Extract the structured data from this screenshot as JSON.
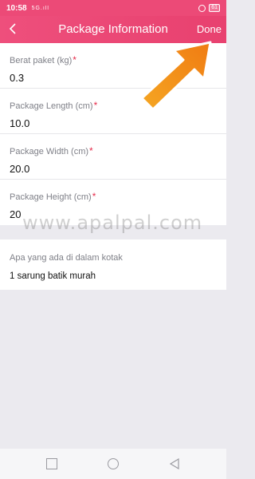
{
  "status_bar": {
    "time": "10:58",
    "signal": "5G.ıll",
    "battery": "61"
  },
  "header": {
    "title": "Package Information",
    "done_label": "Done"
  },
  "fields": [
    {
      "label": "Berat paket (kg)",
      "required_mark": "*",
      "value": "0.3"
    },
    {
      "label": "Package Length (cm)",
      "required_mark": "*",
      "value": "10.0"
    },
    {
      "label": "Package Width (cm)",
      "required_mark": "*",
      "value": "20.0"
    },
    {
      "label": "Package Height (cm)",
      "required_mark": "*",
      "value": "20"
    }
  ],
  "box_contents": {
    "label": "Apa yang ada di dalam kotak",
    "value": "1 sarung batik murah"
  },
  "watermark": "www.apalpal.com",
  "colors": {
    "header": "#e8446f",
    "required": "#e62b4a",
    "arrow": "#f7941d"
  },
  "icons": {
    "back": "chevron-left-icon",
    "nav_recent": "square-icon",
    "nav_home": "circle-icon",
    "nav_back": "triangle-back-icon"
  }
}
